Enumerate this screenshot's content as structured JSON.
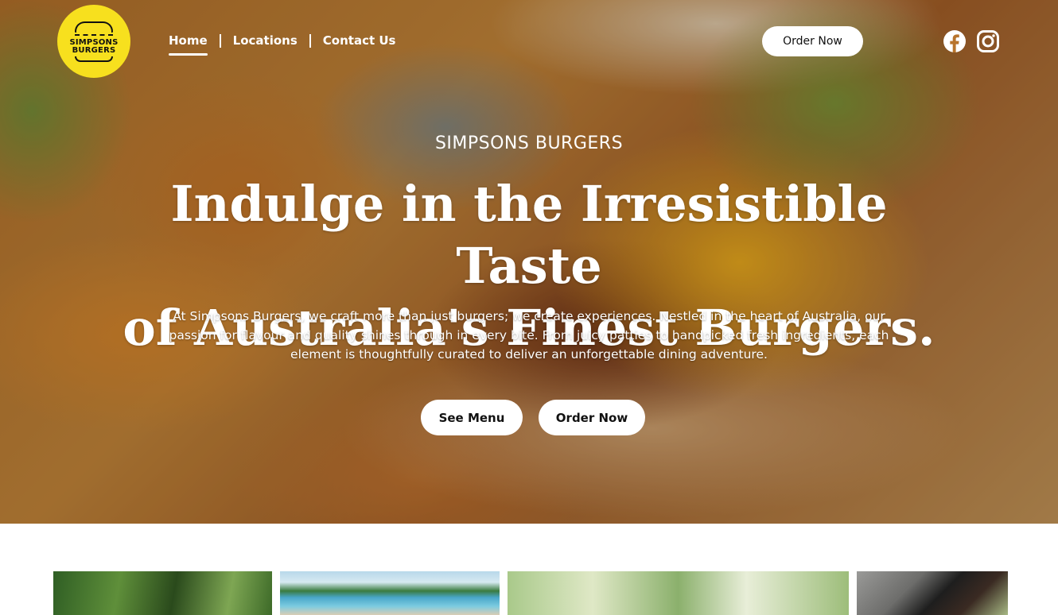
{
  "brand": {
    "logo_line1": "SIMPSONS",
    "logo_line2": "BURGERS",
    "logo_bg": "#f7e01e"
  },
  "nav": {
    "items": [
      {
        "label": "Home",
        "active": true
      },
      {
        "label": "Locations",
        "active": false
      },
      {
        "label": "Contact Us",
        "active": false
      }
    ]
  },
  "header": {
    "order_label": "Order Now",
    "social": [
      {
        "icon": "facebook-icon"
      },
      {
        "icon": "instagram-icon"
      }
    ]
  },
  "hero": {
    "eyebrow": "SIMPSONS BURGERS",
    "headline_line1": "Indulge in the Irresistible Taste",
    "headline_line2": "of Australia's Finest Burgers.",
    "lead_line1": "At Simpsons Burgers, we craft more than just burgers; we create experiences. Nestled in the heart of Australia, our",
    "lead_line2": "passion for flavour and quality shines through in every bite. From juicy patties to handpicked fresh ingredients, each",
    "lead_line3": "element is thoughtfully curated to deliver an unforgettable dining adventure.",
    "cta_menu": "See Menu",
    "cta_order": "Order Now"
  }
}
